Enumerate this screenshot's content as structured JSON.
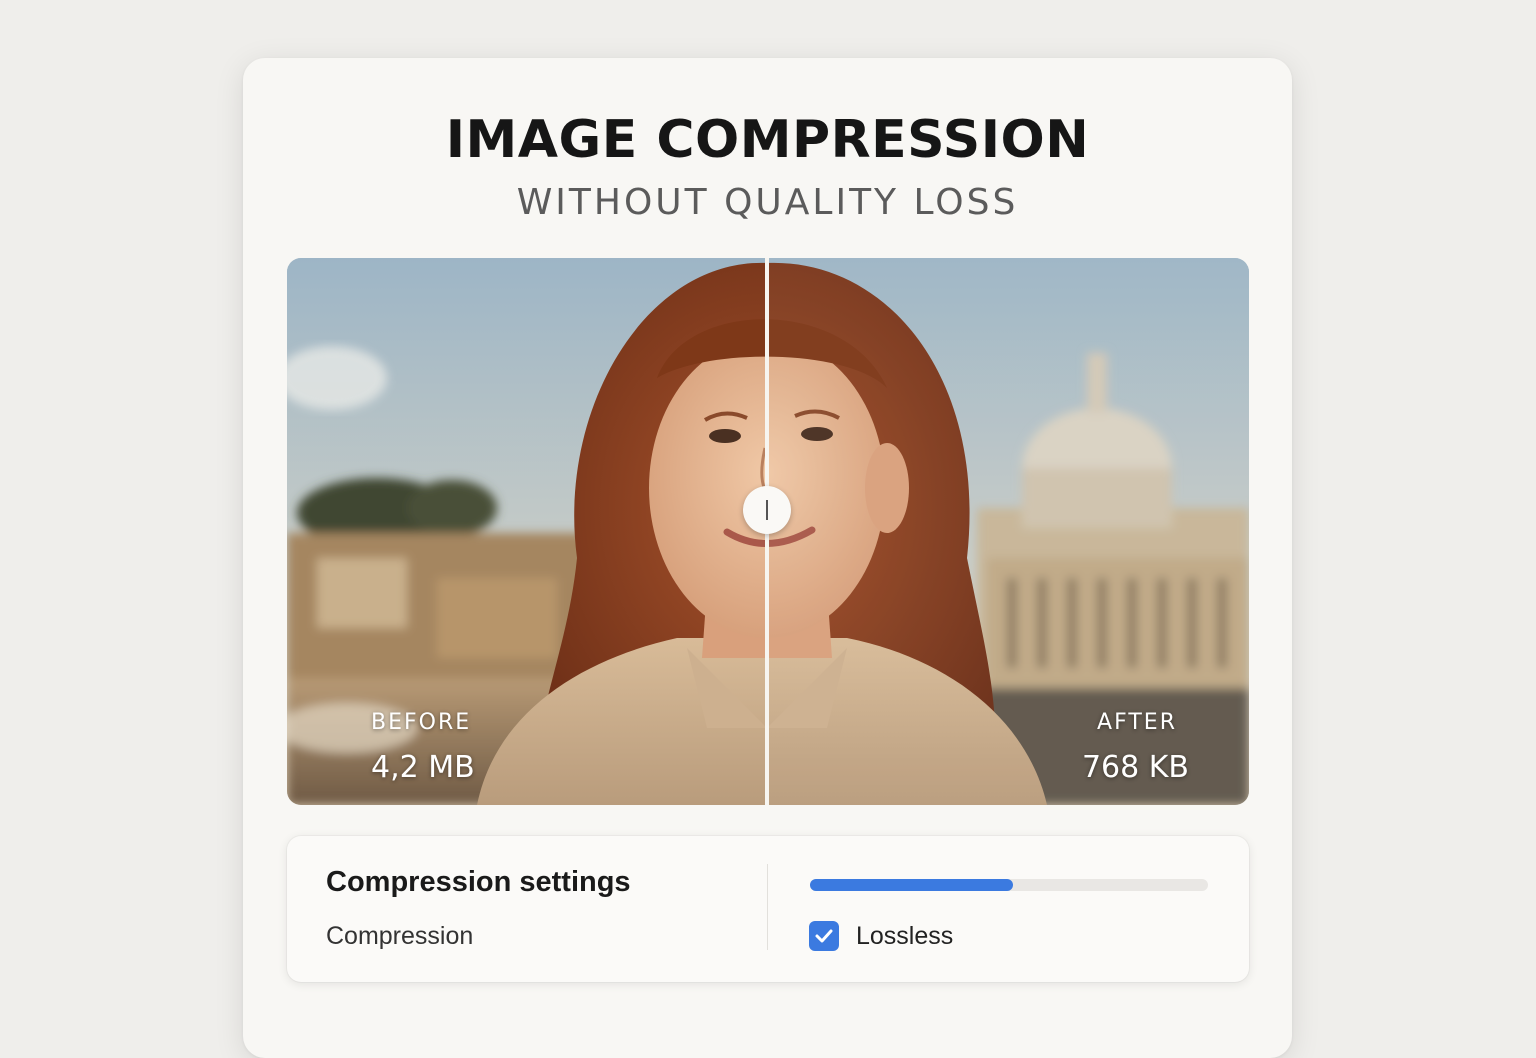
{
  "header": {
    "title": "IMAGE COMPRESSION",
    "subtitle": "WITHOUT QUALITY LOSS"
  },
  "comparison": {
    "before_label": "BEFORE",
    "before_size": "4,2 MB",
    "after_label": "AFTER",
    "after_size": "768 KB",
    "divider_position": 0.5
  },
  "settings": {
    "title": "Compression settings",
    "compression_label": "Compression",
    "slider_value": 0.51,
    "lossless_label": "Lossless",
    "lossless_checked": true
  },
  "colors": {
    "accent": "#3b7ae0",
    "card_background": "#f8f7f4",
    "page_background": "#efeeeb"
  },
  "icons": {
    "checkbox": "check-icon",
    "handle": "drag-handle-icon"
  }
}
